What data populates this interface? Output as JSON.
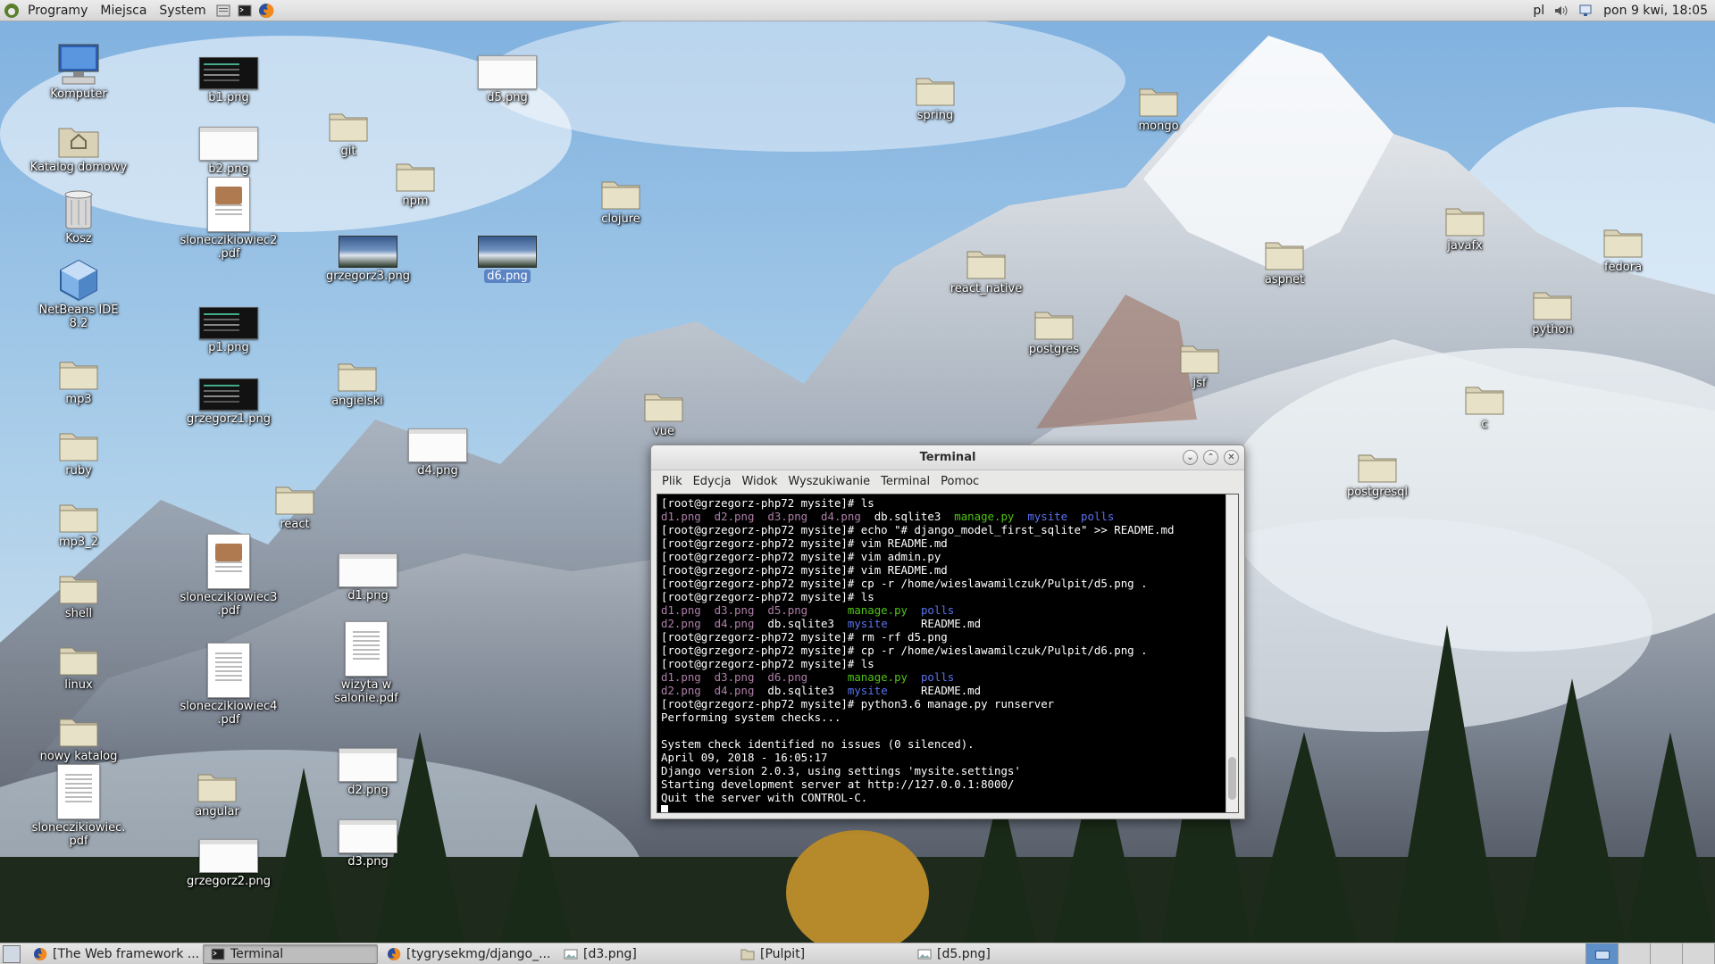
{
  "top_panel": {
    "menus": [
      "Programy",
      "Miejsca",
      "System"
    ],
    "keyboard_layout": "pl",
    "datetime": "pon  9 kwi, 18:05"
  },
  "desktop_icons": [
    {
      "label": "Komputer",
      "type": "computer"
    },
    {
      "label": "Katalog domowy",
      "type": "home"
    },
    {
      "label": "Kosz",
      "type": "trash"
    },
    {
      "label": "NetBeans IDE 8.2",
      "type": "app"
    },
    {
      "label": "mp3",
      "type": "folder"
    },
    {
      "label": "ruby",
      "type": "folder"
    },
    {
      "label": "mp3_2",
      "type": "folder"
    },
    {
      "label": "shell",
      "type": "folder"
    },
    {
      "label": "linux",
      "type": "folder"
    },
    {
      "label": "nowy katalog",
      "type": "folder"
    },
    {
      "label": "sloneczikiowiec.pdf",
      "type": "doc"
    },
    {
      "label": "b1.png",
      "type": "thumb-dark"
    },
    {
      "label": "b2.png",
      "type": "thumb-light"
    },
    {
      "label": "sloneczikiowiec2.pdf",
      "type": "doc-photo"
    },
    {
      "label": "p1.png",
      "type": "thumb-dark"
    },
    {
      "label": "grzegorz1.png",
      "type": "thumb-dark"
    },
    {
      "label": "sloneczikiowiec3.pdf",
      "type": "doc-photo"
    },
    {
      "label": "sloneczikiowiec4.pdf",
      "type": "doc"
    },
    {
      "label": "angular",
      "type": "folder"
    },
    {
      "label": "grzegorz2.png",
      "type": "thumb-light"
    },
    {
      "label": "git",
      "type": "folder"
    },
    {
      "label": "grzegorz3.png",
      "type": "thumb-mount"
    },
    {
      "label": "angielski",
      "type": "folder"
    },
    {
      "label": "react",
      "type": "folder"
    },
    {
      "label": "d1.png",
      "type": "thumb-light"
    },
    {
      "label": "wizyta w salonie.pdf",
      "type": "doc"
    },
    {
      "label": "d2.png",
      "type": "thumb-light"
    },
    {
      "label": "d3.png",
      "type": "thumb-light"
    },
    {
      "label": "npm",
      "type": "folder"
    },
    {
      "label": "d4.png",
      "type": "thumb-light"
    },
    {
      "label": "d5.png",
      "type": "thumb-light"
    },
    {
      "label": "d6.png",
      "type": "thumb-mount",
      "selected": true
    },
    {
      "label": "clojure",
      "type": "folder"
    },
    {
      "label": "vue",
      "type": "folder"
    },
    {
      "label": "spring",
      "type": "folder"
    },
    {
      "label": "react_native",
      "type": "folder"
    },
    {
      "label": "postgres",
      "type": "folder"
    },
    {
      "label": "mongo",
      "type": "folder"
    },
    {
      "label": "jsf",
      "type": "folder"
    },
    {
      "label": "aspnet",
      "type": "folder"
    },
    {
      "label": "javafx",
      "type": "folder"
    },
    {
      "label": "c",
      "type": "folder"
    },
    {
      "label": "postgresql",
      "type": "folder"
    },
    {
      "label": "fedora",
      "type": "folder"
    },
    {
      "label": "python",
      "type": "folder"
    }
  ],
  "terminal": {
    "title": "Terminal",
    "menu": [
      "Plik",
      "Edycja",
      "Widok",
      "Wyszukiwanie",
      "Terminal",
      "Pomoc"
    ],
    "lines": [
      [
        {
          "t": "[root@grzegorz-php72 mysite]# ls",
          "c": "white"
        }
      ],
      [
        {
          "t": "d1.png  d2.png  d3.png  d4.png  ",
          "c": "purple"
        },
        {
          "t": "db.sqlite3  ",
          "c": "white"
        },
        {
          "t": "manage.py  ",
          "c": "green"
        },
        {
          "t": "mysite  polls",
          "c": "blue"
        }
      ],
      [
        {
          "t": "[root@grzegorz-php72 mysite]# echo \"# django_model_first_sqlite\" >> README.md",
          "c": "white"
        }
      ],
      [
        {
          "t": "[root@grzegorz-php72 mysite]# vim README.md",
          "c": "white"
        }
      ],
      [
        {
          "t": "[root@grzegorz-php72 mysite]# vim admin.py",
          "c": "white"
        }
      ],
      [
        {
          "t": "[root@grzegorz-php72 mysite]# vim README.md",
          "c": "white"
        }
      ],
      [
        {
          "t": "[root@grzegorz-php72 mysite]# cp -r /home/wieslawamilczuk/Pulpit/d5.png .",
          "c": "white"
        }
      ],
      [
        {
          "t": "[root@grzegorz-php72 mysite]# ls",
          "c": "white"
        }
      ],
      [
        {
          "t": "d1.png  d3.png  d5.png      ",
          "c": "purple"
        },
        {
          "t": "manage.py  ",
          "c": "green"
        },
        {
          "t": "polls",
          "c": "blue"
        }
      ],
      [
        {
          "t": "d2.png  d4.png  ",
          "c": "purple"
        },
        {
          "t": "db.sqlite3  ",
          "c": "white"
        },
        {
          "t": "mysite     ",
          "c": "blue"
        },
        {
          "t": "README.md",
          "c": "white"
        }
      ],
      [
        {
          "t": "[root@grzegorz-php72 mysite]# rm -rf d5.png",
          "c": "white"
        }
      ],
      [
        {
          "t": "[root@grzegorz-php72 mysite]# cp -r /home/wieslawamilczuk/Pulpit/d6.png .",
          "c": "white"
        }
      ],
      [
        {
          "t": "[root@grzegorz-php72 mysite]# ls",
          "c": "white"
        }
      ],
      [
        {
          "t": "d1.png  d3.png  d6.png      ",
          "c": "purple"
        },
        {
          "t": "manage.py  ",
          "c": "green"
        },
        {
          "t": "polls",
          "c": "blue"
        }
      ],
      [
        {
          "t": "d2.png  d4.png  ",
          "c": "purple"
        },
        {
          "t": "db.sqlite3  ",
          "c": "white"
        },
        {
          "t": "mysite     ",
          "c": "blue"
        },
        {
          "t": "README.md",
          "c": "white"
        }
      ],
      [
        {
          "t": "[root@grzegorz-php72 mysite]# python3.6 manage.py runserver",
          "c": "white"
        }
      ],
      [
        {
          "t": "Performing system checks...",
          "c": "white"
        }
      ],
      [
        {
          "t": "",
          "c": "white"
        }
      ],
      [
        {
          "t": "System check identified no issues (0 silenced).",
          "c": "white"
        }
      ],
      [
        {
          "t": "April 09, 2018 - 16:05:17",
          "c": "white"
        }
      ],
      [
        {
          "t": "Django version 2.0.3, using settings 'mysite.settings'",
          "c": "white"
        }
      ],
      [
        {
          "t": "Starting development server at http://127.0.0.1:8000/",
          "c": "white"
        }
      ],
      [
        {
          "t": "Quit the server with CONTROL-C.",
          "c": "white"
        }
      ]
    ]
  },
  "taskbar": {
    "tasks": [
      {
        "label": "[The Web framework ...",
        "icon": "firefox-icon",
        "active": false
      },
      {
        "label": "Terminal",
        "icon": "terminal-icon",
        "active": true
      },
      {
        "label": "[tygrysekmg/django_...",
        "icon": "firefox-icon",
        "active": false
      },
      {
        "label": "[d3.png]",
        "icon": "image-viewer-icon",
        "active": false
      },
      {
        "label": "[Pulpit]",
        "icon": "folder-icon",
        "active": false
      },
      {
        "label": "[d5.png]",
        "icon": "image-viewer-icon",
        "active": false
      }
    ],
    "workspace_count": 4,
    "active_workspace": 1
  },
  "colors": {
    "selection": "#5b84c4",
    "terminal_bg": "#000000",
    "ls_image": "#ad7fa8",
    "ls_exec": "#4fc414",
    "ls_dir": "#5b72f0"
  }
}
